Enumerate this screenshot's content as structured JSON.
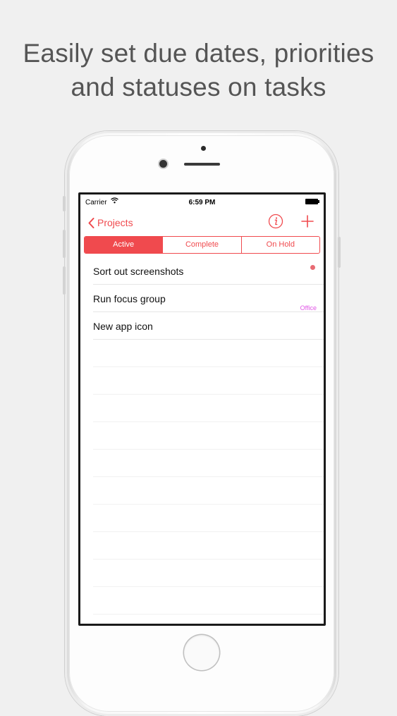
{
  "headline": {
    "line1": "Easily set due dates, priorities",
    "line2": "and statuses on tasks"
  },
  "statusbar": {
    "carrier": "Carrier",
    "wifi_icon": "wifi-icon",
    "time": "6:59 PM",
    "battery_icon": "battery-icon"
  },
  "navbar": {
    "back_label": "Projects",
    "back_icon": "chevron-left-icon",
    "info_icon": "info-icon",
    "add_icon": "plus-icon"
  },
  "segments": [
    {
      "label": "Active",
      "selected": true
    },
    {
      "label": "Complete",
      "selected": false
    },
    {
      "label": "On Hold",
      "selected": false
    }
  ],
  "tasks": [
    {
      "title": "Sort out screenshots",
      "indicator": "priority-dot"
    },
    {
      "title": "Run focus group",
      "tag": "Office"
    },
    {
      "title": "New app icon"
    }
  ],
  "colors": {
    "accent": "#f04a4e",
    "priority_dot": "#e86b73",
    "tag": "#e055e6"
  }
}
